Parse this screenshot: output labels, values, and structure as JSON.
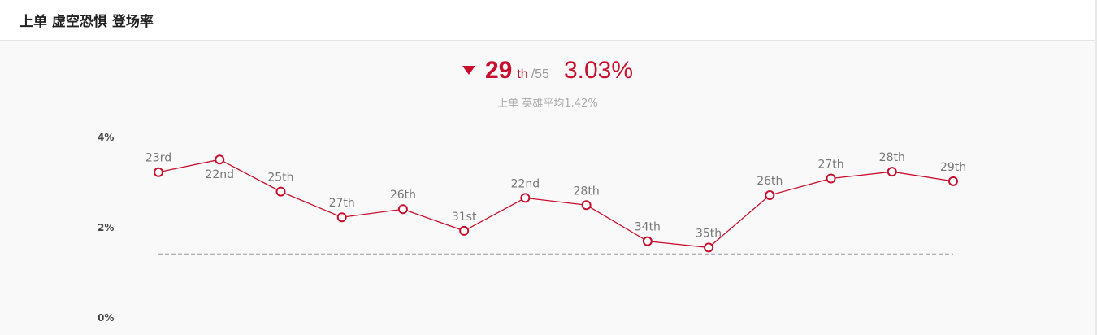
{
  "header": {
    "title": "上单 虚空恐惧 登场率"
  },
  "summary": {
    "rank": "29",
    "rank_suffix": "th",
    "rank_total": "/55",
    "rate": "3.03%",
    "average_text": "上单 英雄平均1.42%"
  },
  "colors": {
    "accent": "#c8102e",
    "average_line": "#999999"
  },
  "chart_data": {
    "type": "line",
    "title": "",
    "xlabel": "",
    "ylabel": "",
    "ylim": [
      0,
      4
    ],
    "yticks": [
      {
        "value": 4,
        "label": "4%"
      },
      {
        "value": 2,
        "label": "2%"
      },
      {
        "value": 0,
        "label": "0%"
      }
    ],
    "grid": false,
    "series": [
      {
        "values": [
          3.23,
          3.51,
          2.8,
          2.23,
          2.41,
          1.93,
          2.66,
          2.5,
          1.7,
          1.56,
          2.72,
          3.09,
          3.24,
          3.03
        ],
        "labels": [
          "23rd",
          "22nd",
          "25th",
          "27th",
          "26th",
          "31st",
          "22nd",
          "28th",
          "34th",
          "35th",
          "26th",
          "27th",
          "28th",
          "29th"
        ],
        "label_position": [
          "above",
          "below",
          "above",
          "above",
          "above",
          "above",
          "above",
          "above",
          "above",
          "above",
          "above",
          "above",
          "above",
          "above"
        ]
      }
    ],
    "reference_line": {
      "value": 1.42,
      "style": "dashed"
    }
  }
}
